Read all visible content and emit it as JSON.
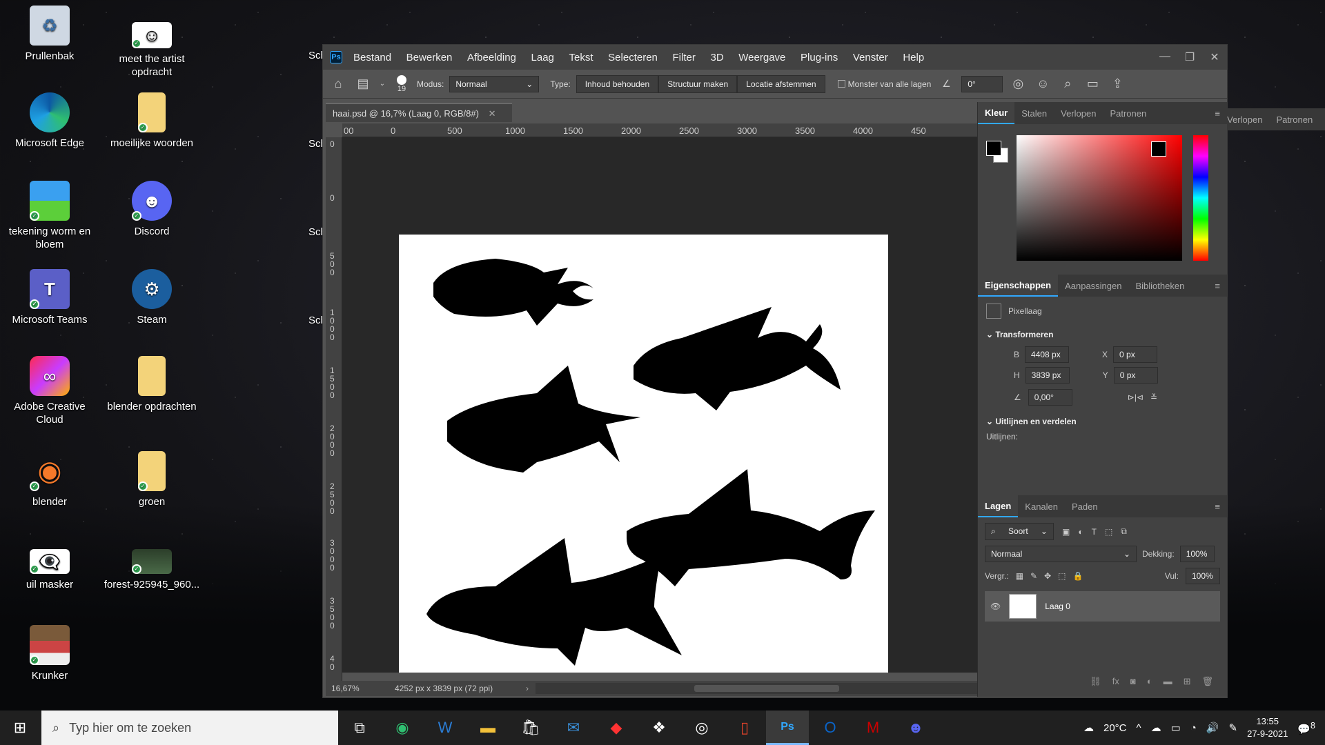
{
  "desktop": {
    "col1": [
      {
        "label": "Prullenbak",
        "icon": "recycle-bin-icon"
      },
      {
        "label": "Microsoft Edge",
        "icon": "edge-icon"
      },
      {
        "label": "tekening worm en bloem",
        "icon": "image-file-icon"
      },
      {
        "label": "Microsoft Teams",
        "icon": "teams-icon"
      },
      {
        "label": "Adobe Creative Cloud",
        "icon": "creative-cloud-icon"
      },
      {
        "label": "blender",
        "icon": "blender-icon"
      },
      {
        "label": "uil masker",
        "icon": "psd-file-icon"
      },
      {
        "label": "Krunker",
        "icon": "krunker-icon"
      }
    ],
    "col2": [
      {
        "label": "meet the artist opdracht",
        "icon": "psd-file-icon"
      },
      {
        "label": "moeilijke woorden",
        "icon": "folder-icon"
      },
      {
        "label": "Discord",
        "icon": "discord-icon"
      },
      {
        "label": "Steam",
        "icon": "steam-icon"
      },
      {
        "label": "blender opdrachten",
        "icon": "folder-icon"
      },
      {
        "label": "groen",
        "icon": "folder-icon"
      },
      {
        "label": "forest-925945_960...",
        "icon": "image-file-icon"
      }
    ],
    "partial": [
      "Sch",
      "Sch",
      "Sch",
      "Sch"
    ]
  },
  "photoshop": {
    "logo": "Ps",
    "menu": [
      "Bestand",
      "Bewerken",
      "Afbeelding",
      "Laag",
      "Tekst",
      "Selecteren",
      "Filter",
      "3D",
      "Weergave",
      "Plug-ins",
      "Venster",
      "Help"
    ],
    "options": {
      "brush_size": "19",
      "mode_label": "Modus:",
      "mode_value": "Normaal",
      "type_label": "Type:",
      "type_buttons": [
        "Inhoud behouden",
        "Structuur maken",
        "Locatie afstemmen"
      ],
      "sample_all": "Monster van alle lagen",
      "angle": "0°"
    },
    "doc_tab": "haai.psd @ 16,7% (Laag 0, RGB/8#)",
    "ruler_top": [
      "00",
      "0",
      "500",
      "1000",
      "1500",
      "2000",
      "2500",
      "3000",
      "3500",
      "4000",
      "450"
    ],
    "ruler_left": [
      "0",
      "0",
      "500",
      "1000",
      "1500",
      "2000",
      "2500",
      "3000",
      "3500",
      "40"
    ],
    "status": {
      "zoom": "16,67%",
      "info": "4252 px x 3839 px (72 ppi)"
    },
    "color_panel": {
      "tabs": [
        "Kleur",
        "Stalen",
        "Verlopen",
        "Patronen"
      ],
      "fg": "#000000",
      "bg": "#ffffff",
      "hue": "#ff0000"
    },
    "properties": {
      "tabs": [
        "Eigenschappen",
        "Aanpassingen",
        "Bibliotheken"
      ],
      "type": "Pixellaag",
      "section_transform": "Transformeren",
      "w_label": "B",
      "w": "4408 px",
      "h_label": "H",
      "h": "3839 px",
      "x_label": "X",
      "x": "0 px",
      "y_label": "Y",
      "y": "0 px",
      "angle": "0,00°",
      "section_align": "Uitlijnen en verdelen",
      "align_label": "Uitlijnen:"
    },
    "layers": {
      "tabs": [
        "Lagen",
        "Kanalen",
        "Paden"
      ],
      "filter": "Soort",
      "blend": "Normaal",
      "opacity_label": "Dekking:",
      "opacity": "100%",
      "lock_label": "Vergr.:",
      "fill_label": "Vul:",
      "fill": "100%",
      "layer_name": "Laag 0"
    }
  },
  "taskbar": {
    "search_placeholder": "Typ hier om te zoeken",
    "temperature": "20°C",
    "time": "13:55",
    "date": "27-9-2021",
    "notification_count": "8"
  }
}
